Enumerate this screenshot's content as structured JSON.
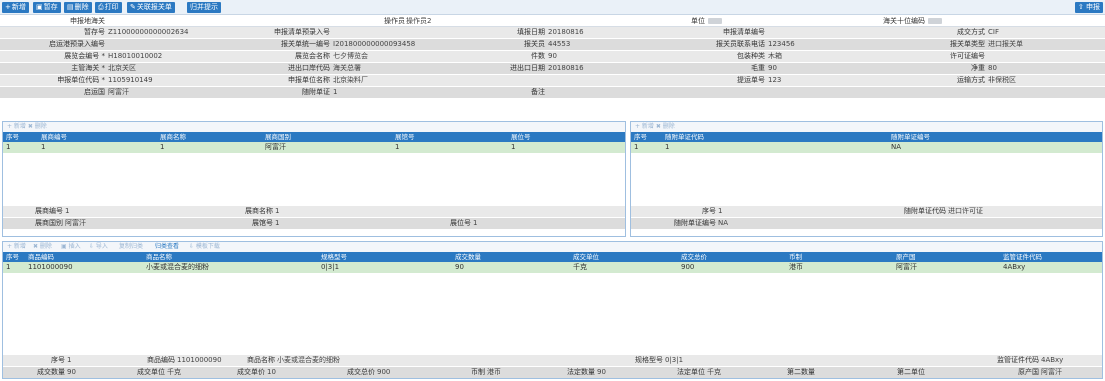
{
  "toolbar": {
    "buttons": [
      {
        "icon": "+",
        "label": "新增"
      },
      {
        "icon": "▣",
        "label": "暂存"
      },
      {
        "icon": "▤",
        "label": "删除"
      },
      {
        "icon": "⎙",
        "label": "打印"
      },
      {
        "icon": "✎",
        "label": "关联报关单"
      },
      {
        "icon": "",
        "label": "归并提示"
      }
    ],
    "right_button": {
      "icon": "⇧",
      "label": "申报"
    }
  },
  "header_line": {
    "customs_label": "申报地海关",
    "operator_label": "操作员",
    "operator_value": "操作员2",
    "unit_label": "单位",
    "code_label": "海关十位编码"
  },
  "form": {
    "rows": [
      [
        [
          "暂存号",
          "Z11000000000002634"
        ],
        [
          "申报清单预录入号",
          ""
        ],
        [
          "填报日期",
          "20180816"
        ],
        [
          "申报清单编号",
          ""
        ],
        [
          "成交方式",
          "CIF"
        ]
      ],
      [
        [
          "启运港预录入编号",
          ""
        ],
        [
          "报关单统一编号",
          "I201800000000093458"
        ],
        [
          "报关员",
          "44553"
        ],
        [
          "报关员联系电话",
          "123456"
        ],
        [
          "报关单类型",
          "进口报关单"
        ]
      ],
      [
        [
          "展览会编号 *",
          "H18010010002"
        ],
        [
          "展览会名称",
          "七夕博览会"
        ],
        [
          "件数",
          "90"
        ],
        [
          "包装种类",
          "木箱"
        ],
        [
          "许可证编号",
          ""
        ]
      ],
      [
        [
          "主管海关 *",
          "北京关区"
        ],
        [
          "进出口岸代码",
          "海关总署"
        ],
        [
          "进出口日期",
          "20180816"
        ],
        [
          "毛重",
          "90"
        ],
        [
          "净重",
          "80"
        ]
      ],
      [
        [
          "申报单位代码 *",
          "1105910149"
        ],
        [
          "申报单位名称",
          "北京染料厂"
        ],
        [
          "",
          ""
        ],
        [
          "提运单号",
          "123"
        ],
        [
          "运输方式",
          "非保税区"
        ]
      ],
      [
        [
          "启运国",
          "阿富汗"
        ],
        [
          "随附单证",
          "1"
        ],
        [
          "备注",
          ""
        ],
        [
          "",
          ""
        ],
        [
          "",
          ""
        ]
      ]
    ]
  },
  "booth_panel": {
    "toolbar": "+ 新增  ✖ 删除",
    "headers": [
      "序号",
      "展商编号",
      "展商名称",
      "展商国别",
      "展馆号",
      "展位号"
    ],
    "rows": [
      [
        "1",
        "1",
        "1",
        "阿富汗",
        "1",
        "1"
      ]
    ],
    "detail": {
      "exhibitor_no_label": "展商编号",
      "exhibitor_no": "1",
      "exhibitor_name_label": "展商名称",
      "exhibitor_name": "1",
      "country_label": "展商国别",
      "country": "阿富汗",
      "hall_label": "展馆号",
      "hall": "1",
      "booth_label": "展位号",
      "booth": "1"
    }
  },
  "doc_panel": {
    "toolbar": "+ 新增  ✖ 删除",
    "headers": [
      "序号",
      "随附单证代码",
      "随附单证编号"
    ],
    "rows": [
      [
        "1",
        "1",
        "NA"
      ]
    ],
    "detail": {
      "seq_label": "序号",
      "seq": "1",
      "code_label": "随附单证代码",
      "code": "进口许可证",
      "no_label": "随附单证编号",
      "no": "NA"
    }
  },
  "goods_panel": {
    "toolbar": [
      "+ 新增",
      "✖ 删除",
      "▣ 插入",
      "⇩ 导入",
      "复制归类",
      "归类查看",
      "⇩ 模板下载"
    ],
    "headers": [
      "序号",
      "商品编码",
      "商品名称",
      "规格型号",
      "成交数量",
      "成交单位",
      "成交总价",
      "币制",
      "原产国",
      "监管证件代码"
    ],
    "rows": [
      [
        "1",
        "1101000090",
        "小麦或混合麦的细粉",
        "0|3|1",
        "90",
        "千克",
        "900",
        "港币",
        "阿富汗",
        "4ABxy"
      ]
    ],
    "detail_row1": {
      "seq_label": "序号",
      "seq": "1",
      "code_label": "商品编码",
      "code": "1101000090",
      "name_label": "商品名称",
      "name": "小麦或混合麦的细粉",
      "spec_label": "规格型号",
      "spec": "0|3|1",
      "license_label": "监管证件代码",
      "license": "4ABxy"
    },
    "detail_row2": {
      "qty_label": "成交数量",
      "qty": "90",
      "unit_label": "成交单位",
      "unit": "千克",
      "price_label": "成交单价",
      "price": "10",
      "total_label": "成交总价",
      "total": "900",
      "currency_label": "币制",
      "currency": "港币",
      "legal_qty_label": "法定数量",
      "legal_qty": "90",
      "legal_unit_label": "法定单位",
      "legal_unit": "千克",
      "second_qty_label": "第二数量",
      "second_qty": "",
      "second_unit_label": "第二单位",
      "second_unit": "",
      "origin_label": "原产国",
      "origin": "阿富汗"
    }
  }
}
